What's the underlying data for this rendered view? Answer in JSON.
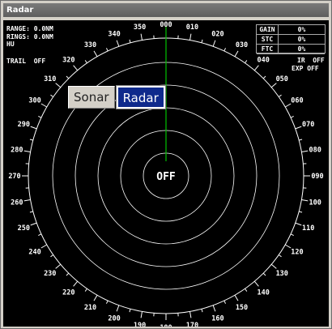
{
  "window": {
    "title": "Radar"
  },
  "status": {
    "range": "RANGE: 0.0NM",
    "rings": "RINGS: 0.0NM",
    "orientation": "HU",
    "trail": "TRAIL  OFF",
    "ir": "IR  OFF",
    "exp": "EXP OFF",
    "center_state": "OFF"
  },
  "gain_table": [
    {
      "label": "GAIN",
      "value": "0%"
    },
    {
      "label": "STC",
      "value": "0%"
    },
    {
      "label": "FTC",
      "value": "0%"
    }
  ],
  "tabs": {
    "sonar": "Sonar",
    "radar": "Radar"
  },
  "bearing_labels": [
    "000",
    "010",
    "020",
    "030",
    "040",
    "050",
    "060",
    "070",
    "080",
    "090",
    "100",
    "110",
    "120",
    "130",
    "140",
    "150",
    "160",
    "170",
    "180",
    "190",
    "200",
    "210",
    "220",
    "230",
    "240",
    "250",
    "260",
    "270",
    "280",
    "290",
    "300",
    "310",
    "320",
    "330",
    "340",
    "350"
  ],
  "colors": {
    "heading_line": "#00c000",
    "rings": "#ffffff",
    "background": "#000000",
    "selected_tab": "#0f2a8c"
  }
}
